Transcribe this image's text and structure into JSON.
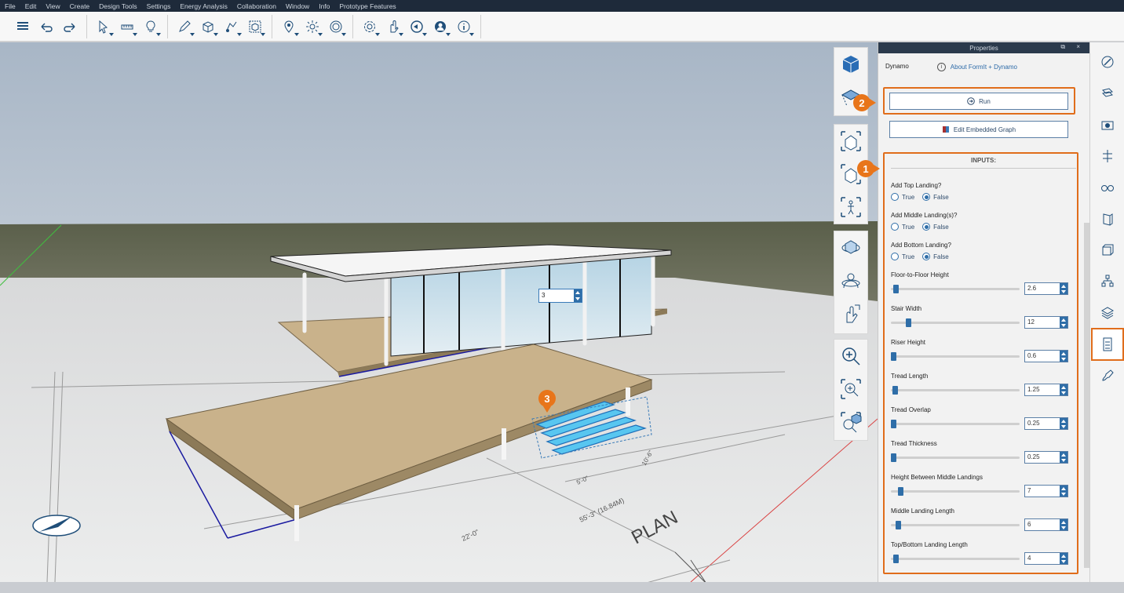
{
  "menu": [
    "File",
    "Edit",
    "View",
    "Create",
    "Design Tools",
    "Settings",
    "Energy Analysis",
    "Collaboration",
    "Window",
    "Info",
    "Prototype Features"
  ],
  "toolbar": {
    "groups": [
      [
        "layers-icon",
        "undo-icon",
        "redo-icon"
      ],
      [
        "select-icon",
        "measure-icon",
        "lightbulb-icon"
      ],
      [
        "pencil-icon",
        "solid-icon",
        "transform-icon",
        "group-icon"
      ],
      [
        "location-pin-icon",
        "sun-icon",
        "time-clock-icon"
      ],
      [
        "settings-gear-icon",
        "gesture-hand-icon",
        "share-icon",
        "user-account-icon",
        "info-icon"
      ]
    ]
  },
  "viewport": {
    "dimension_value": "3",
    "stair_callout": "3",
    "labels": [
      "PLAN",
      "22'-0\"",
      "55'-3\" (16.84M)",
      "5'-0\"",
      "10'-6\""
    ]
  },
  "view_tools": {
    "panel1": [
      "view-cube-icon",
      "perspective-view-icon"
    ],
    "panel2": [
      "zoom-extents-home-icon",
      "zoom-selected-home-icon",
      "zoom-fit-person-icon"
    ],
    "panel3": [
      "orbit-icon",
      "look-around-icon",
      "pan-hand-icon"
    ],
    "panel4": [
      "zoom-icon",
      "zoom-window-icon",
      "zoom-to-fit-icon"
    ]
  },
  "properties": {
    "title": "Properties",
    "window_controls": "⧉ ×",
    "dynamo_label": "Dynamo",
    "about_link": "About FormIt + Dynamo",
    "run_label": "Run",
    "edit_graph_label": "Edit Embedded Graph",
    "callout_run": "2",
    "callout_inputs": "1",
    "inputs_title": "INPUTS:",
    "boolean_inputs": [
      {
        "label": "Add Top Landing?",
        "true_label": "True",
        "false_label": "False",
        "value": false
      },
      {
        "label": "Add Middle Landing(s)?",
        "true_label": "True",
        "false_label": "False",
        "value": false
      },
      {
        "label": "Add Bottom Landing?",
        "true_label": "True",
        "false_label": "False",
        "value": false
      }
    ],
    "number_inputs": [
      {
        "label": "Floor-to-Floor Height",
        "value": "2.6",
        "fraction": 0.02
      },
      {
        "label": "Stair Width",
        "value": "12",
        "fraction": 0.12
      },
      {
        "label": "Riser Height",
        "value": "0.6",
        "fraction": 0.0
      },
      {
        "label": "Tread Length",
        "value": "1.25",
        "fraction": 0.01
      },
      {
        "label": "Tread Overlap",
        "value": "0.25",
        "fraction": 0.0
      },
      {
        "label": "Tread Thickness",
        "value": "0.25",
        "fraction": 0.0
      },
      {
        "label": "Height Between Middle Landings",
        "value": "7",
        "fraction": 0.06
      },
      {
        "label": "Middle Landing Length",
        "value": "6",
        "fraction": 0.04
      },
      {
        "label": "Top/Bottom Landing Length",
        "value": "4",
        "fraction": 0.02
      }
    ]
  },
  "right_strip": [
    "materials-brush-icon",
    "layers-stack-icon",
    "scenes-camera-icon",
    "levels-icon",
    "visual-styles-glasses-icon",
    "groups-icon",
    "components-icon",
    "hierarchy-icon",
    "content-library-icon",
    "properties-sliders-icon",
    "paint-icon"
  ],
  "colors": {
    "accent_orange": "#e06d1b",
    "selection_blue": "#2f6ea8",
    "header_dark": "#1e2a3a"
  }
}
